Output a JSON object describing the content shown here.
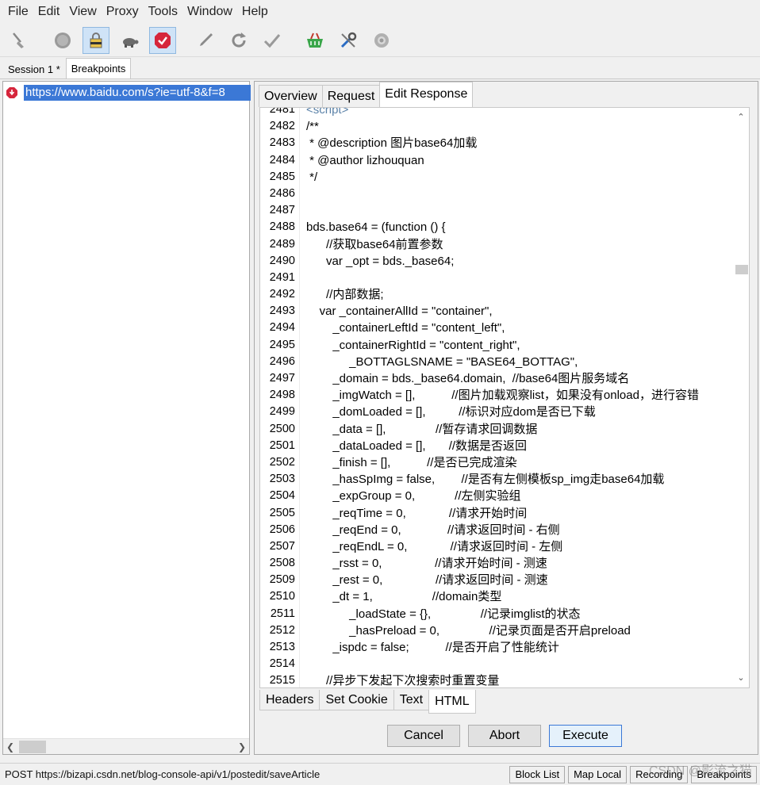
{
  "menu": [
    "File",
    "Edit",
    "View",
    "Proxy",
    "Tools",
    "Window",
    "Help"
  ],
  "session_tabs": [
    {
      "label": "Session 1 *",
      "active": false
    },
    {
      "label": "Breakpoints",
      "active": true
    }
  ],
  "request": {
    "url": "https://www.baidu.com/s?ie=utf-8&f=8"
  },
  "right_tabs": [
    {
      "label": "Overview",
      "active": false
    },
    {
      "label": "Request",
      "active": false
    },
    {
      "label": "Edit Response",
      "active": true
    }
  ],
  "code": [
    {
      "n": "2481",
      "t": "<script>",
      "tag": true
    },
    {
      "n": "2482",
      "t": "/**"
    },
    {
      "n": "2483",
      "t": " * @description 图片base64加载"
    },
    {
      "n": "2484",
      "t": " * @author lizhouquan"
    },
    {
      "n": "2485",
      "t": " */"
    },
    {
      "n": "2486",
      "t": ""
    },
    {
      "n": "2487",
      "t": ""
    },
    {
      "n": "2488",
      "t": "bds.base64 = (function () {"
    },
    {
      "n": "2489",
      "t": "      //获取base64前置参数"
    },
    {
      "n": "2490",
      "t": "      var _opt = bds._base64;"
    },
    {
      "n": "2491",
      "t": ""
    },
    {
      "n": "2492",
      "t": "      //内部数据;"
    },
    {
      "n": "2493",
      "t": "    var _containerAllId = \"container\","
    },
    {
      "n": "2494",
      "t": "        _containerLeftId = \"content_left\","
    },
    {
      "n": "2495",
      "t": "        _containerRightId = \"content_right\","
    },
    {
      "n": "2496",
      "t": "             _BOTTAGLSNAME = \"BASE64_BOTTAG\","
    },
    {
      "n": "2497",
      "t": "        _domain = bds._base64.domain,  //base64图片服务域名"
    },
    {
      "n": "2498",
      "t": "        _imgWatch = [],           //图片加载观察list，如果没有onload，进行容错"
    },
    {
      "n": "2499",
      "t": "        _domLoaded = [],          //标识对应dom是否已下载"
    },
    {
      "n": "2500",
      "t": "        _data = [],               //暂存请求回调数据"
    },
    {
      "n": "2501",
      "t": "        _dataLoaded = [],       //数据是否返回"
    },
    {
      "n": "2502",
      "t": "        _finish = [],           //是否已完成渲染"
    },
    {
      "n": "2503",
      "t": "        _hasSpImg = false,        //是否有左侧模板sp_img走base64加载"
    },
    {
      "n": "2504",
      "t": "        _expGroup = 0,            //左侧实验组"
    },
    {
      "n": "2505",
      "t": "        _reqTime = 0,             //请求开始时间"
    },
    {
      "n": "2506",
      "t": "        _reqEnd = 0,              //请求返回时间 - 右侧"
    },
    {
      "n": "2507",
      "t": "        _reqEndL = 0,             //请求返回时间 - 左侧"
    },
    {
      "n": "2508",
      "t": "        _rsst = 0,                //请求开始时间 - 测速"
    },
    {
      "n": "2509",
      "t": "        _rest = 0,                //请求返回时间 - 测速"
    },
    {
      "n": "2510",
      "t": "        _dt = 1,                  //domain类型"
    },
    {
      "n": "2511",
      "t": "             _loadState = {},               //记录imglist的状态"
    },
    {
      "n": "2512",
      "t": "             _hasPreload = 0,               //记录页面是否开启preload"
    },
    {
      "n": "2513",
      "t": "        _ispdc = false;           //是否开启了性能统计"
    },
    {
      "n": "2514",
      "t": ""
    },
    {
      "n": "2515",
      "t": "      //异步下发起下次搜索时重置变量"
    }
  ],
  "bottom_tabs": [
    {
      "label": "Headers",
      "active": false
    },
    {
      "label": "Set Cookie",
      "active": false
    },
    {
      "label": "Text",
      "active": false
    },
    {
      "label": "HTML",
      "active": true
    }
  ],
  "buttons": {
    "cancel": "Cancel",
    "abort": "Abort",
    "execute": "Execute"
  },
  "status": {
    "text": "POST https://bizapi.csdn.net/blog-console-api/v1/postedit/saveArticle",
    "buttons": [
      "Block List",
      "Map Local",
      "Recording",
      "Breakpoints"
    ],
    "watermark": "CSDN @影流之猫"
  },
  "colors": {
    "selection": "#3b78d6",
    "breakpoint": "#d6263c"
  }
}
